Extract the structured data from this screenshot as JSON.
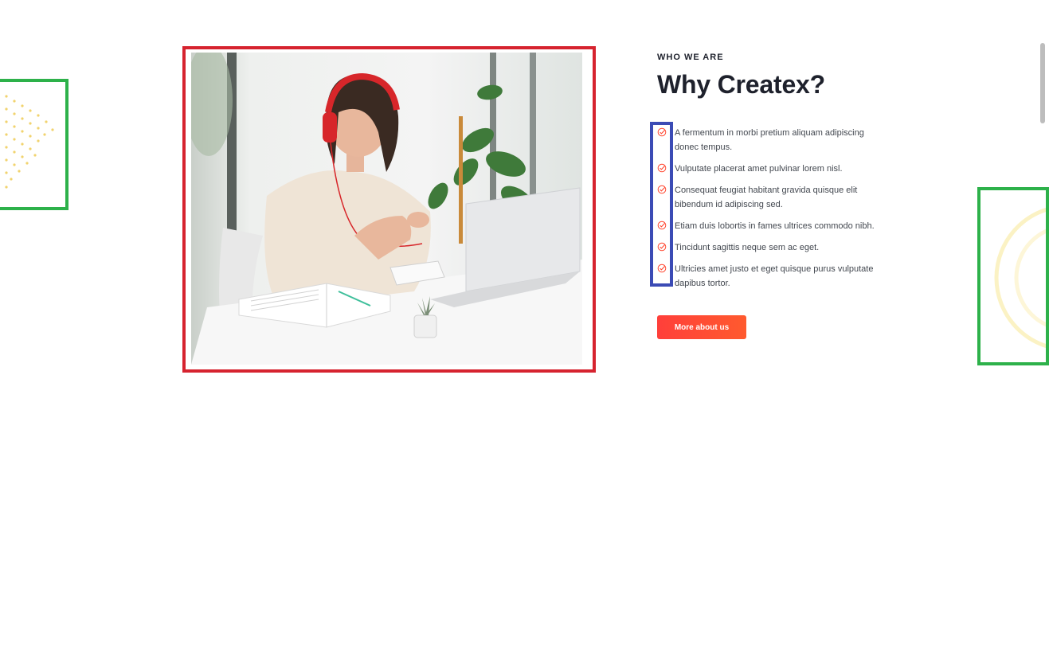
{
  "section": {
    "eyebrow": "WHO WE ARE",
    "title": "Why Createx?",
    "features": [
      "A fermentum in morbi pretium aliquam adipiscing donec tempus.",
      "Vulputate placerat amet pulvinar lorem nisl.",
      "Consequat feugiat habitant gravida quisque elit bibendum id adipiscing sed.",
      "Etiam duis lobortis in fames ultrices commodo nibh.",
      "Tincidunt sagittis neque sem ac eget.",
      "Ultricies amet justo et eget quisque purus vulputate dapibus tortor."
    ],
    "cta_label": "More about us"
  },
  "colors": {
    "accent": "#ff4a34",
    "heading": "#1e212c",
    "body_text": "#42474f",
    "highlight_red": "#d6232f",
    "highlight_green": "#2db14a",
    "highlight_blue": "#3b4bb5",
    "deco_yellow": "#f5d76e"
  },
  "icons": {
    "feature_check": "check-circle-icon",
    "deco_left": "dots-pattern-icon",
    "deco_right": "concentric-arcs-icon"
  }
}
